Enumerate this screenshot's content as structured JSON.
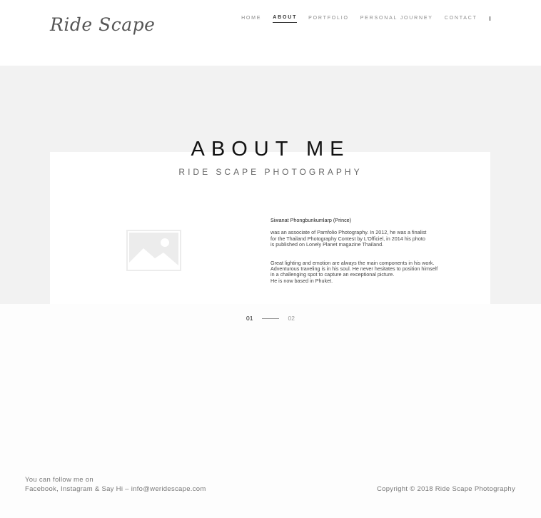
{
  "logo": {
    "text": "Ride Scape"
  },
  "nav": {
    "items": [
      {
        "label": "HOME"
      },
      {
        "label": "ABOUT"
      },
      {
        "label": "PORTFOLIO"
      },
      {
        "label": "PERSONAL JOURNEY"
      },
      {
        "label": "CONTACT"
      }
    ],
    "menu_icon": "ǁ"
  },
  "hero": {
    "title": "ABOUT ME",
    "subtitle": "RIDE SCAPE PHOTOGRAPHY"
  },
  "image": {
    "icon": "image-placeholder-icon"
  },
  "bio": {
    "name": "Siwanat Phongbunkumlarp (Prince)",
    "paragraphs": [
      "was an associate of Pamfolio Photography. In 2012, he was a finalist\nfor the Thailand Photography Contest by L'Officiel, in 2014 his photo\nis published on Lonely Planet magazine Thailand.",
      "Great lighting and emotion are always the main components in his work.\nAdventurous traveling is in his soul. He never hesitates to position himself\nin a challenging spot to capture an exceptional picture.\nHe is now based in Phuket."
    ]
  },
  "pager": {
    "current": "01",
    "next": "02"
  },
  "footer": {
    "follow_line1": "You can follow me on",
    "follow_line2": "Facebook, Instagram & Say Hi – info@weridescape.com",
    "copyright": "Copyright © 2018 Ride Scape Photography"
  },
  "colors": {
    "band_bg": "#f2f2f2",
    "card_bg": "#ffffff",
    "placeholder": "#ececec"
  }
}
